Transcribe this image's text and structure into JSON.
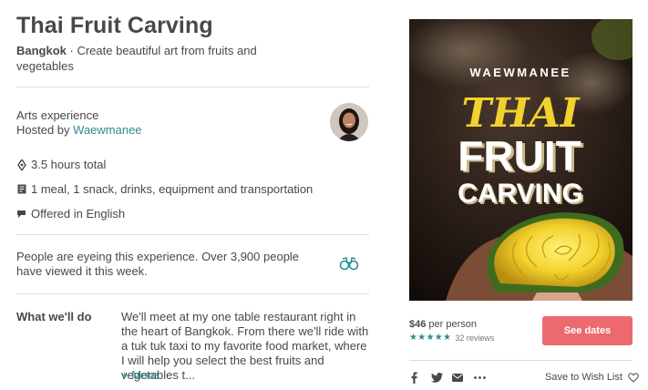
{
  "experience": {
    "title": "Thai Fruit Carving",
    "city": "Bangkok",
    "subtitle_rest": " · Create beautiful art from fruits and vegetables",
    "category": "Arts experience",
    "hosted_by_prefix": "Hosted by ",
    "host_name": "Waewmanee"
  },
  "details": {
    "duration": "3.5 hours total",
    "includes": "1 meal, 1 snack, drinks, equipment and transportation",
    "language": "Offered in English"
  },
  "social_proof": "People are eyeing this experience. Over 3,900 people have viewed it this week.",
  "what_we_do": {
    "label": "What we'll do",
    "text": "We'll meet at my one table restaurant right in the heart of Bangkok. From there we'll ride with a tuk tuk taxi to my favorite food market, where I will help you select the best fruits and vegetables t...",
    "more_link": "+ More"
  },
  "hero": {
    "host_word": "WAEWMANEE",
    "word_1": "THAI",
    "word_2": "FRUIT",
    "word_3": "CARVING"
  },
  "booking": {
    "price": "$46",
    "per_person": " per person",
    "stars": "★★★★★",
    "rating_value": 5,
    "reviews": "32 reviews",
    "cta": "See dates"
  },
  "share": {
    "icons": [
      "facebook-icon",
      "twitter-icon",
      "email-icon",
      "more-icon"
    ],
    "wish_list": "Save to Wish List"
  },
  "colors": {
    "accent": "#ec6a6e",
    "link": "#2d8a94",
    "stars": "#2a8f8f",
    "title_yellow": "#f2d22e"
  }
}
